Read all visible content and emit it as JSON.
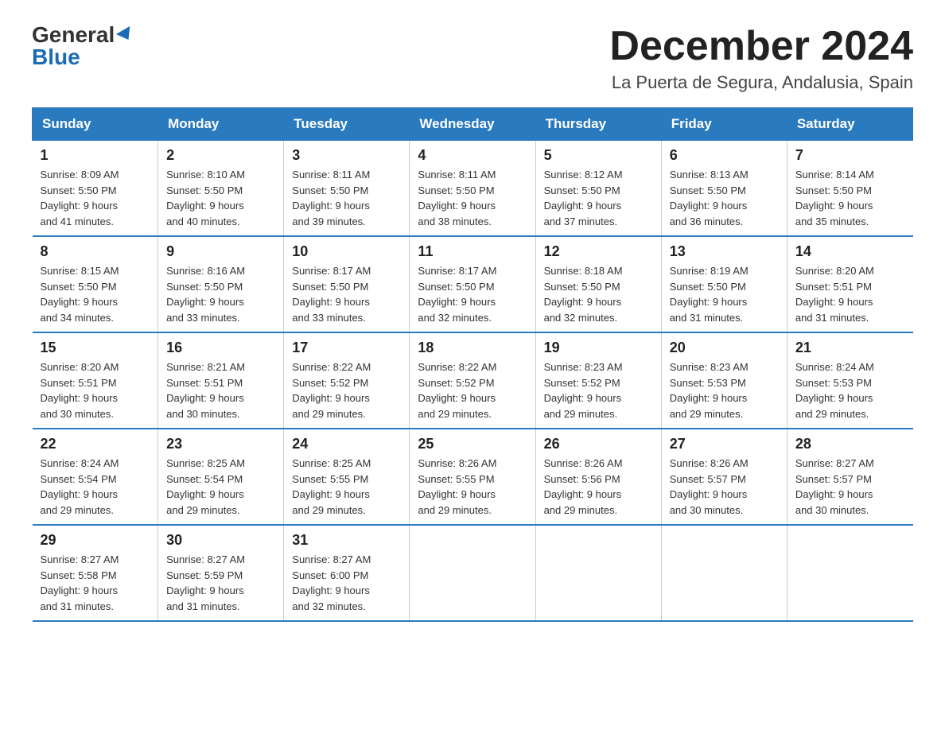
{
  "logo": {
    "general": "General",
    "blue": "Blue"
  },
  "title": {
    "month_year": "December 2024",
    "location": "La Puerta de Segura, Andalusia, Spain"
  },
  "headers": [
    "Sunday",
    "Monday",
    "Tuesday",
    "Wednesday",
    "Thursday",
    "Friday",
    "Saturday"
  ],
  "weeks": [
    [
      {
        "day": "1",
        "sunrise": "8:09 AM",
        "sunset": "5:50 PM",
        "daylight": "9 hours and 41 minutes."
      },
      {
        "day": "2",
        "sunrise": "8:10 AM",
        "sunset": "5:50 PM",
        "daylight": "9 hours and 40 minutes."
      },
      {
        "day": "3",
        "sunrise": "8:11 AM",
        "sunset": "5:50 PM",
        "daylight": "9 hours and 39 minutes."
      },
      {
        "day": "4",
        "sunrise": "8:11 AM",
        "sunset": "5:50 PM",
        "daylight": "9 hours and 38 minutes."
      },
      {
        "day": "5",
        "sunrise": "8:12 AM",
        "sunset": "5:50 PM",
        "daylight": "9 hours and 37 minutes."
      },
      {
        "day": "6",
        "sunrise": "8:13 AM",
        "sunset": "5:50 PM",
        "daylight": "9 hours and 36 minutes."
      },
      {
        "day": "7",
        "sunrise": "8:14 AM",
        "sunset": "5:50 PM",
        "daylight": "9 hours and 35 minutes."
      }
    ],
    [
      {
        "day": "8",
        "sunrise": "8:15 AM",
        "sunset": "5:50 PM",
        "daylight": "9 hours and 34 minutes."
      },
      {
        "day": "9",
        "sunrise": "8:16 AM",
        "sunset": "5:50 PM",
        "daylight": "9 hours and 33 minutes."
      },
      {
        "day": "10",
        "sunrise": "8:17 AM",
        "sunset": "5:50 PM",
        "daylight": "9 hours and 33 minutes."
      },
      {
        "day": "11",
        "sunrise": "8:17 AM",
        "sunset": "5:50 PM",
        "daylight": "9 hours and 32 minutes."
      },
      {
        "day": "12",
        "sunrise": "8:18 AM",
        "sunset": "5:50 PM",
        "daylight": "9 hours and 32 minutes."
      },
      {
        "day": "13",
        "sunrise": "8:19 AM",
        "sunset": "5:50 PM",
        "daylight": "9 hours and 31 minutes."
      },
      {
        "day": "14",
        "sunrise": "8:20 AM",
        "sunset": "5:51 PM",
        "daylight": "9 hours and 31 minutes."
      }
    ],
    [
      {
        "day": "15",
        "sunrise": "8:20 AM",
        "sunset": "5:51 PM",
        "daylight": "9 hours and 30 minutes."
      },
      {
        "day": "16",
        "sunrise": "8:21 AM",
        "sunset": "5:51 PM",
        "daylight": "9 hours and 30 minutes."
      },
      {
        "day": "17",
        "sunrise": "8:22 AM",
        "sunset": "5:52 PM",
        "daylight": "9 hours and 29 minutes."
      },
      {
        "day": "18",
        "sunrise": "8:22 AM",
        "sunset": "5:52 PM",
        "daylight": "9 hours and 29 minutes."
      },
      {
        "day": "19",
        "sunrise": "8:23 AM",
        "sunset": "5:52 PM",
        "daylight": "9 hours and 29 minutes."
      },
      {
        "day": "20",
        "sunrise": "8:23 AM",
        "sunset": "5:53 PM",
        "daylight": "9 hours and 29 minutes."
      },
      {
        "day": "21",
        "sunrise": "8:24 AM",
        "sunset": "5:53 PM",
        "daylight": "9 hours and 29 minutes."
      }
    ],
    [
      {
        "day": "22",
        "sunrise": "8:24 AM",
        "sunset": "5:54 PM",
        "daylight": "9 hours and 29 minutes."
      },
      {
        "day": "23",
        "sunrise": "8:25 AM",
        "sunset": "5:54 PM",
        "daylight": "9 hours and 29 minutes."
      },
      {
        "day": "24",
        "sunrise": "8:25 AM",
        "sunset": "5:55 PM",
        "daylight": "9 hours and 29 minutes."
      },
      {
        "day": "25",
        "sunrise": "8:26 AM",
        "sunset": "5:55 PM",
        "daylight": "9 hours and 29 minutes."
      },
      {
        "day": "26",
        "sunrise": "8:26 AM",
        "sunset": "5:56 PM",
        "daylight": "9 hours and 29 minutes."
      },
      {
        "day": "27",
        "sunrise": "8:26 AM",
        "sunset": "5:57 PM",
        "daylight": "9 hours and 30 minutes."
      },
      {
        "day": "28",
        "sunrise": "8:27 AM",
        "sunset": "5:57 PM",
        "daylight": "9 hours and 30 minutes."
      }
    ],
    [
      {
        "day": "29",
        "sunrise": "8:27 AM",
        "sunset": "5:58 PM",
        "daylight": "9 hours and 31 minutes."
      },
      {
        "day": "30",
        "sunrise": "8:27 AM",
        "sunset": "5:59 PM",
        "daylight": "9 hours and 31 minutes."
      },
      {
        "day": "31",
        "sunrise": "8:27 AM",
        "sunset": "6:00 PM",
        "daylight": "9 hours and 32 minutes."
      },
      null,
      null,
      null,
      null
    ]
  ],
  "labels": {
    "sunrise_prefix": "Sunrise: ",
    "sunset_prefix": "Sunset: ",
    "daylight_prefix": "Daylight: "
  }
}
